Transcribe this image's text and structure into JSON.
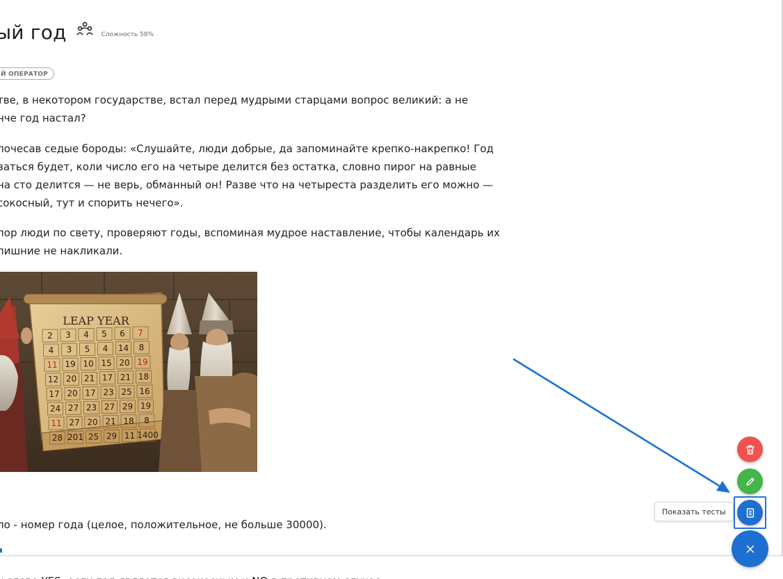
{
  "problem": {
    "title": "ый год",
    "difficulty": "Сложность 58%",
    "tag": "Й ОПЕРАТОР",
    "icons": {
      "participants": "people-group-icon"
    }
  },
  "statement": {
    "paragraphs": [
      [
        "тве, в некотором государстве, встал перед мудрыми старцами вопрос великий: а не",
        "нче год настал?"
      ],
      [
        "почесав седые бороды: «Слушайте, люди добрые, да запоминайте крепко-накрепко! Год",
        "ваться будет, коли число его на четыре делится без остатка, словно пирог на равные",
        "на сто делится — не верь, обманный он! Разве что на четыреста разделить его можно —",
        "сокосный, тут и спорить нечего»."
      ],
      [
        "пор люди по свету, проверяют годы, вспоминая мудрое наставление, чтобы календарь их",
        "лишние не накликали."
      ]
    ],
    "image": {
      "banner_text": "LEAP YEAR",
      "calendar_rows": [
        [
          "2",
          "3",
          "4",
          "5",
          "6",
          "7"
        ],
        [
          "4",
          "3",
          "5",
          "4",
          "14",
          "8"
        ],
        [
          "11",
          "19",
          "10",
          "15",
          "20",
          "19"
        ],
        [
          "12",
          "20",
          "21",
          "17",
          "21",
          "18"
        ],
        [
          "17",
          "20",
          "17",
          "23",
          "25",
          "16"
        ],
        [
          "24",
          "27",
          "23",
          "27",
          "29",
          "19"
        ],
        [
          "11",
          "27",
          "20",
          "21",
          "18",
          "8"
        ],
        [
          "28",
          "201",
          "25",
          "29",
          "11",
          "1400"
        ]
      ]
    },
    "input_line": "ло - номер года (целое, положительное, не больше 30000).",
    "cut_line": "у слово YES, если год является високосным и NO в противном случае."
  },
  "fab": {
    "delete_icon": "trash-icon",
    "edit_icon": "pencil-icon",
    "tests_icon": "document-icon",
    "close_icon": "close-icon",
    "tooltip": "Показать тесты",
    "colors": {
      "delete": "#ef5350",
      "edit": "#43b549",
      "primary": "#1e6fd0"
    }
  },
  "annotation": {
    "color": "#1b73d1"
  }
}
